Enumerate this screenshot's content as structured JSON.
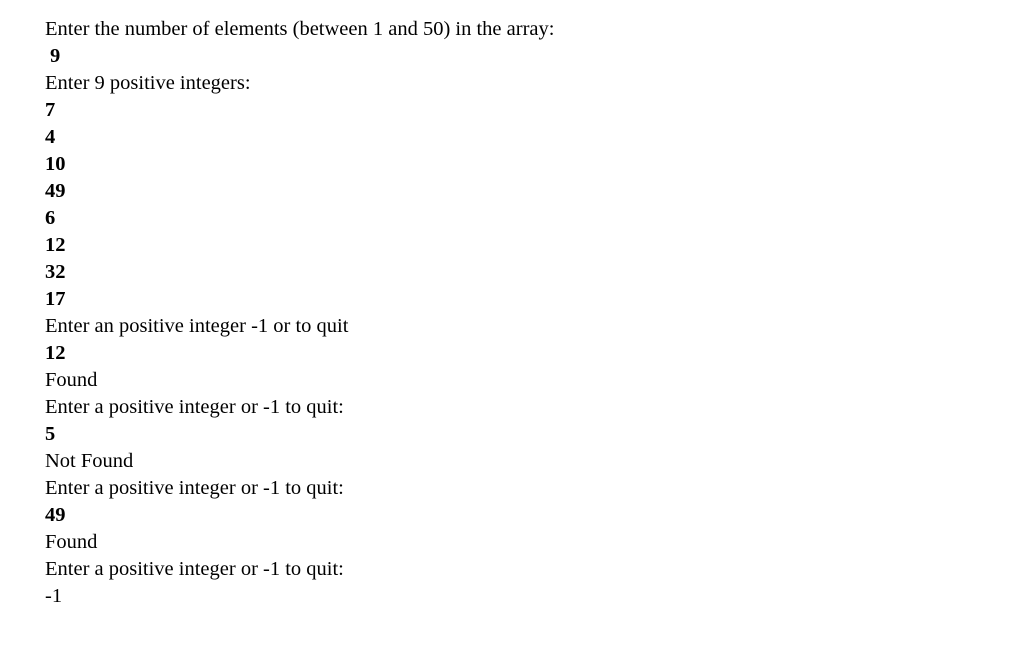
{
  "lines": [
    {
      "text": "Enter the number of elements (between 1 and 50) in the array:",
      "kind": "prompt"
    },
    {
      "text": "9",
      "kind": "input"
    },
    {
      "text": "Enter 9 positive integers:",
      "kind": "prompt"
    },
    {
      "text": "7",
      "kind": "input"
    },
    {
      "text": "4",
      "kind": "input"
    },
    {
      "text": "10",
      "kind": "input"
    },
    {
      "text": "49",
      "kind": "input"
    },
    {
      "text": "6",
      "kind": "input"
    },
    {
      "text": "12",
      "kind": "input"
    },
    {
      "text": "32",
      "kind": "input"
    },
    {
      "text": "17",
      "kind": "input"
    },
    {
      "text": "Enter an positive integer -1 or to quit",
      "kind": "prompt"
    },
    {
      "text": "12",
      "kind": "input"
    },
    {
      "text": "Found",
      "kind": "output"
    },
    {
      "text": "Enter a positive integer or -1 to quit:",
      "kind": "prompt"
    },
    {
      "text": "5",
      "kind": "input"
    },
    {
      "text": "Not Found",
      "kind": "output"
    },
    {
      "text": "Enter a positive integer or -1 to quit:",
      "kind": "prompt"
    },
    {
      "text": "49",
      "kind": "input"
    },
    {
      "text": "Found",
      "kind": "output"
    },
    {
      "text": "Enter a positive integer or -1 to quit:",
      "kind": "prompt"
    },
    {
      "text": "-1",
      "kind": "input-plain"
    }
  ]
}
